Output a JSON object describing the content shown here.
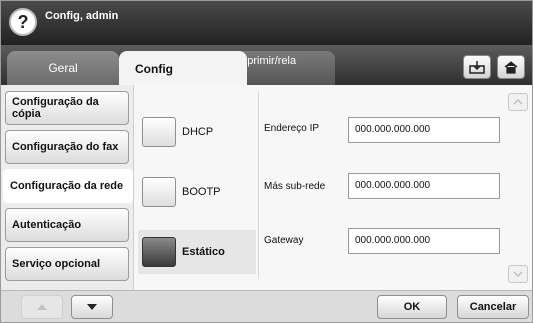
{
  "header": {
    "title": "Config, admin",
    "help_icon": "question-icon",
    "help_glyph": "?"
  },
  "tabs": [
    {
      "label": "Geral",
      "active": false
    },
    {
      "label": "Config",
      "active": true
    },
    {
      "label": "Imprimir/rela\nt.",
      "active": false
    }
  ],
  "tab_buttons": [
    {
      "icon": "tray-icon"
    },
    {
      "icon": "home-icon"
    }
  ],
  "sidebar": {
    "items": [
      {
        "label": "Configuração da cópia",
        "active": false
      },
      {
        "label": "Configuração do fax",
        "active": false
      },
      {
        "label": "Configuração da rede",
        "active": true
      },
      {
        "label": "Autenticação",
        "active": false
      },
      {
        "label": "Serviço opcional",
        "active": false
      }
    ]
  },
  "ip_modes": [
    {
      "label": "DHCP",
      "selected": false
    },
    {
      "label": "BOOTP",
      "selected": false
    },
    {
      "label": "Estático",
      "selected": true
    }
  ],
  "fields": [
    {
      "label": "Endereço IP",
      "value": "000.000.000.000"
    },
    {
      "label": "Más sub-rede",
      "value": "000.000.000.000"
    },
    {
      "label": "Gateway",
      "value": "000.000.000.000"
    }
  ],
  "footer": {
    "ok_label": "OK",
    "cancel_label": "Cancelar"
  },
  "colors": {
    "title_bar": "#2a2a2a",
    "selected_radio": "#4a4a4a",
    "panel_bg": "#f7f7f7"
  }
}
